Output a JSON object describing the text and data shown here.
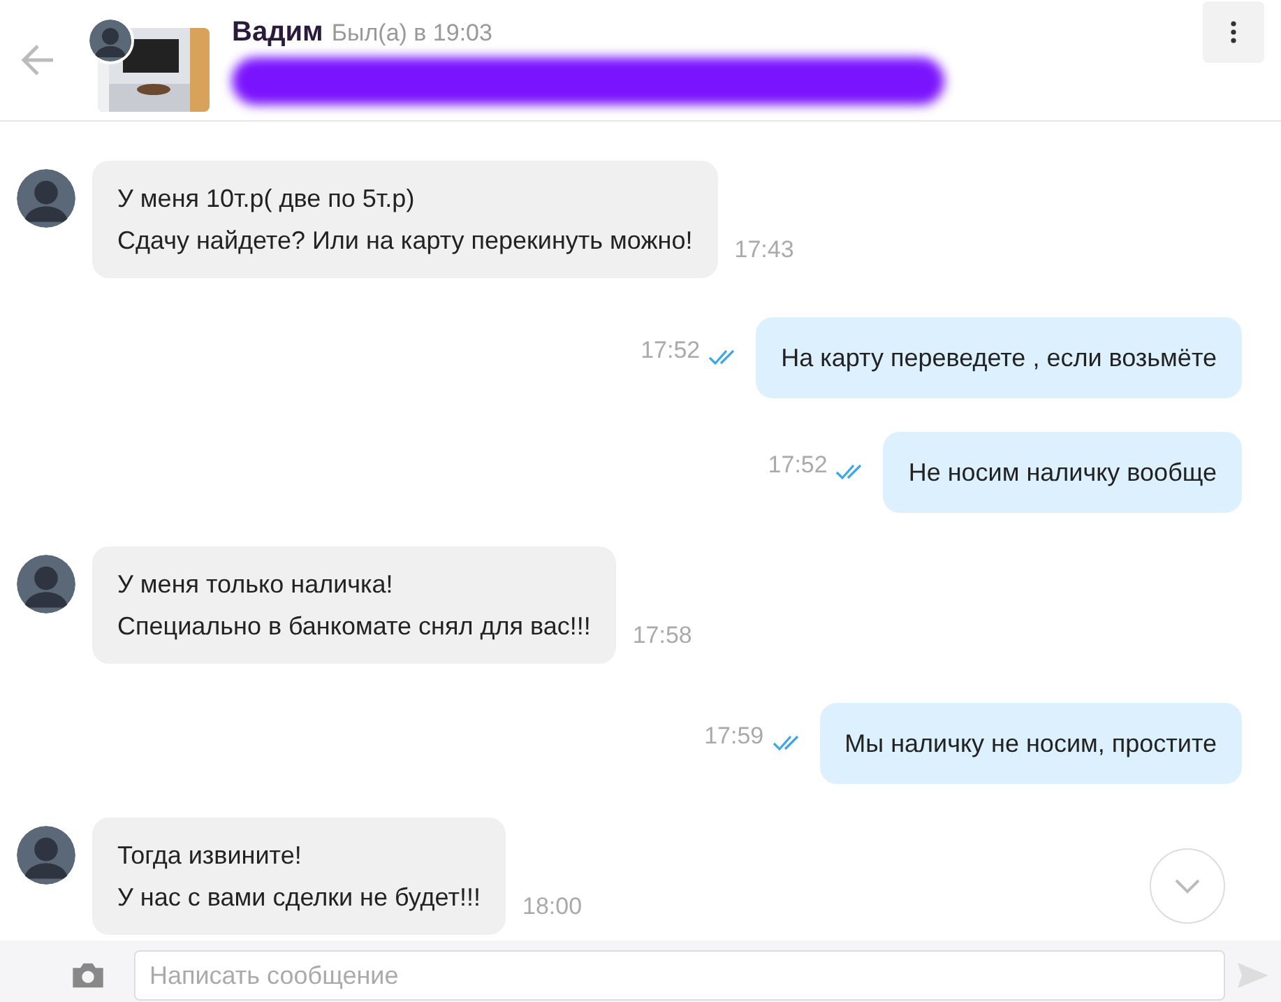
{
  "header": {
    "name": "Вадим",
    "status": "Был(а) в 19:03",
    "subtitle_redacted": true
  },
  "messages": [
    {
      "kind": "in",
      "lines": [
        "У меня 10т.р( две по 5т.р)",
        "Сдачу найдете? Или на карту перекинуть можно!"
      ],
      "time": "17:43"
    },
    {
      "kind": "out",
      "lines": [
        "На карту переведете , если возьмёте"
      ],
      "time": "17:52",
      "read": true
    },
    {
      "kind": "out",
      "lines": [
        "Не носим наличку вообще"
      ],
      "time": "17:52",
      "read": true
    },
    {
      "kind": "in",
      "lines": [
        "У меня только наличка!",
        "Специально в банкомате снял для вас!!!"
      ],
      "time": "17:58"
    },
    {
      "kind": "out",
      "lines": [
        "Мы наличку не носим, простите"
      ],
      "time": "17:59",
      "read": true
    },
    {
      "kind": "in",
      "lines": [
        "Тогда извините!",
        "У нас с вами сделки не будет!!!"
      ],
      "time": "18:00"
    }
  ],
  "composer": {
    "placeholder": "Написать сообщение"
  }
}
